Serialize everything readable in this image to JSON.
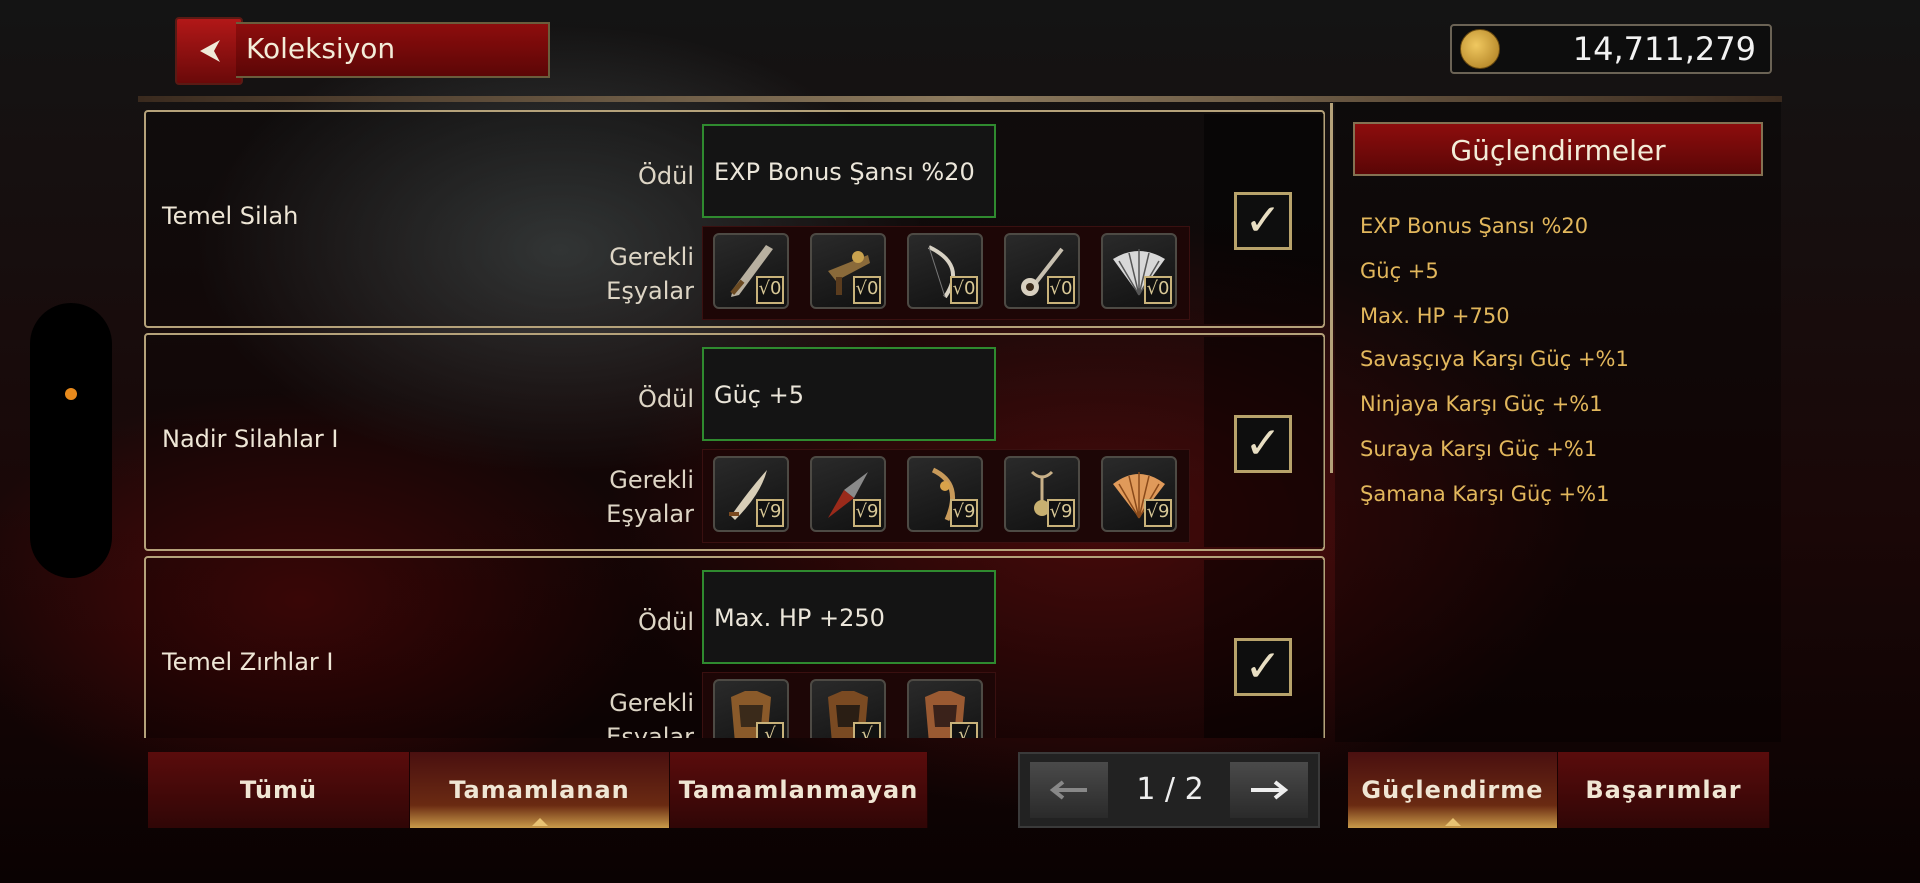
{
  "header": {
    "title": "Koleksiyon",
    "gold": "14,711,279"
  },
  "collections": [
    {
      "name": "Temel Silah",
      "reward_label": "Ödül",
      "reward": "EXP Bonus Şansı %20",
      "required_label_1": "Gerekli",
      "required_label_2": "Eşyalar",
      "items": [
        {
          "icon": "sword-icon",
          "check": "√0"
        },
        {
          "icon": "crossbow-icon",
          "check": "√0"
        },
        {
          "icon": "bow-icon",
          "check": "√0"
        },
        {
          "icon": "staff-icon",
          "check": "√0"
        },
        {
          "icon": "fan-icon",
          "check": "√0"
        }
      ],
      "completed": true
    },
    {
      "name": "Nadir Silahlar I",
      "reward_label": "Ödül",
      "reward": "Güç +5",
      "required_label_1": "Gerekli",
      "required_label_2": "Eşyalar",
      "items": [
        {
          "icon": "sword-icon",
          "check": "√9"
        },
        {
          "icon": "dagger-icon",
          "check": "√9"
        },
        {
          "icon": "bow-icon",
          "check": "√9"
        },
        {
          "icon": "staff-icon",
          "check": "√9"
        },
        {
          "icon": "fan-icon",
          "check": "√9"
        }
      ],
      "completed": true
    },
    {
      "name": "Temel Zırhlar I",
      "reward_label": "Ödül",
      "reward": "Max. HP +250",
      "required_label_1": "Gerekli",
      "required_label_2": "Eşyalar",
      "items": [
        {
          "icon": "armor-icon",
          "check": "√"
        },
        {
          "icon": "armor-icon",
          "check": "√"
        },
        {
          "icon": "armor-icon",
          "check": "√"
        }
      ],
      "completed": true
    }
  ],
  "right_panel": {
    "title": "Güçlendirmeler",
    "bonuses": [
      "EXP Bonus Şansı %20",
      "Güç +5",
      "Max. HP +750",
      "Savaşçıya Karşı Güç +%1",
      "Ninjaya Karşı Güç +%1",
      "Suraya Karşı Güç +%1",
      "Şamana Karşı Güç +%1"
    ]
  },
  "filter_tabs": {
    "all": "Tümü",
    "completed": "Tamamlanan",
    "incomplete": "Tamamlanmayan",
    "active": "completed"
  },
  "pager": {
    "text": "1 / 2"
  },
  "view_tabs": {
    "boosts": "Güçlendirme",
    "achievements": "Başarımlar",
    "active": "boosts"
  },
  "colors": {
    "accent_red": "#8d0d0d",
    "bonus_gold": "#e2b75c",
    "reward_border": "#2f8a2f",
    "card_border": "#b5a27a"
  }
}
